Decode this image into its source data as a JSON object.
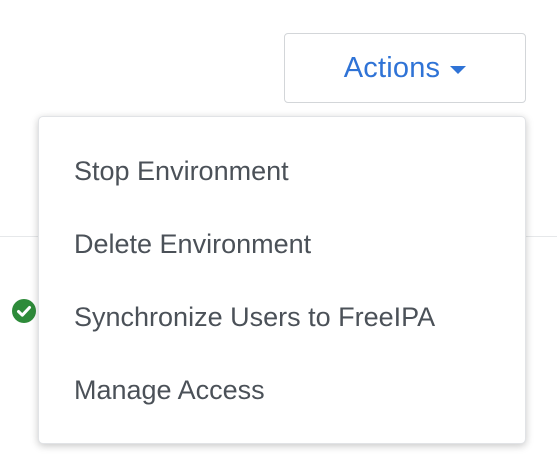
{
  "actions_button": {
    "label": "Actions",
    "caret_icon": "caret-down-icon",
    "accent_color": "#2f73d6"
  },
  "dropdown": {
    "items": [
      {
        "label": "Stop Environment"
      },
      {
        "label": "Delete Environment"
      },
      {
        "label": "Synchronize Users to FreeIPA"
      },
      {
        "label": "Manage Access"
      }
    ]
  },
  "background": {
    "status_icon": "check-circle-icon",
    "status_color": "#2e8b3a"
  }
}
